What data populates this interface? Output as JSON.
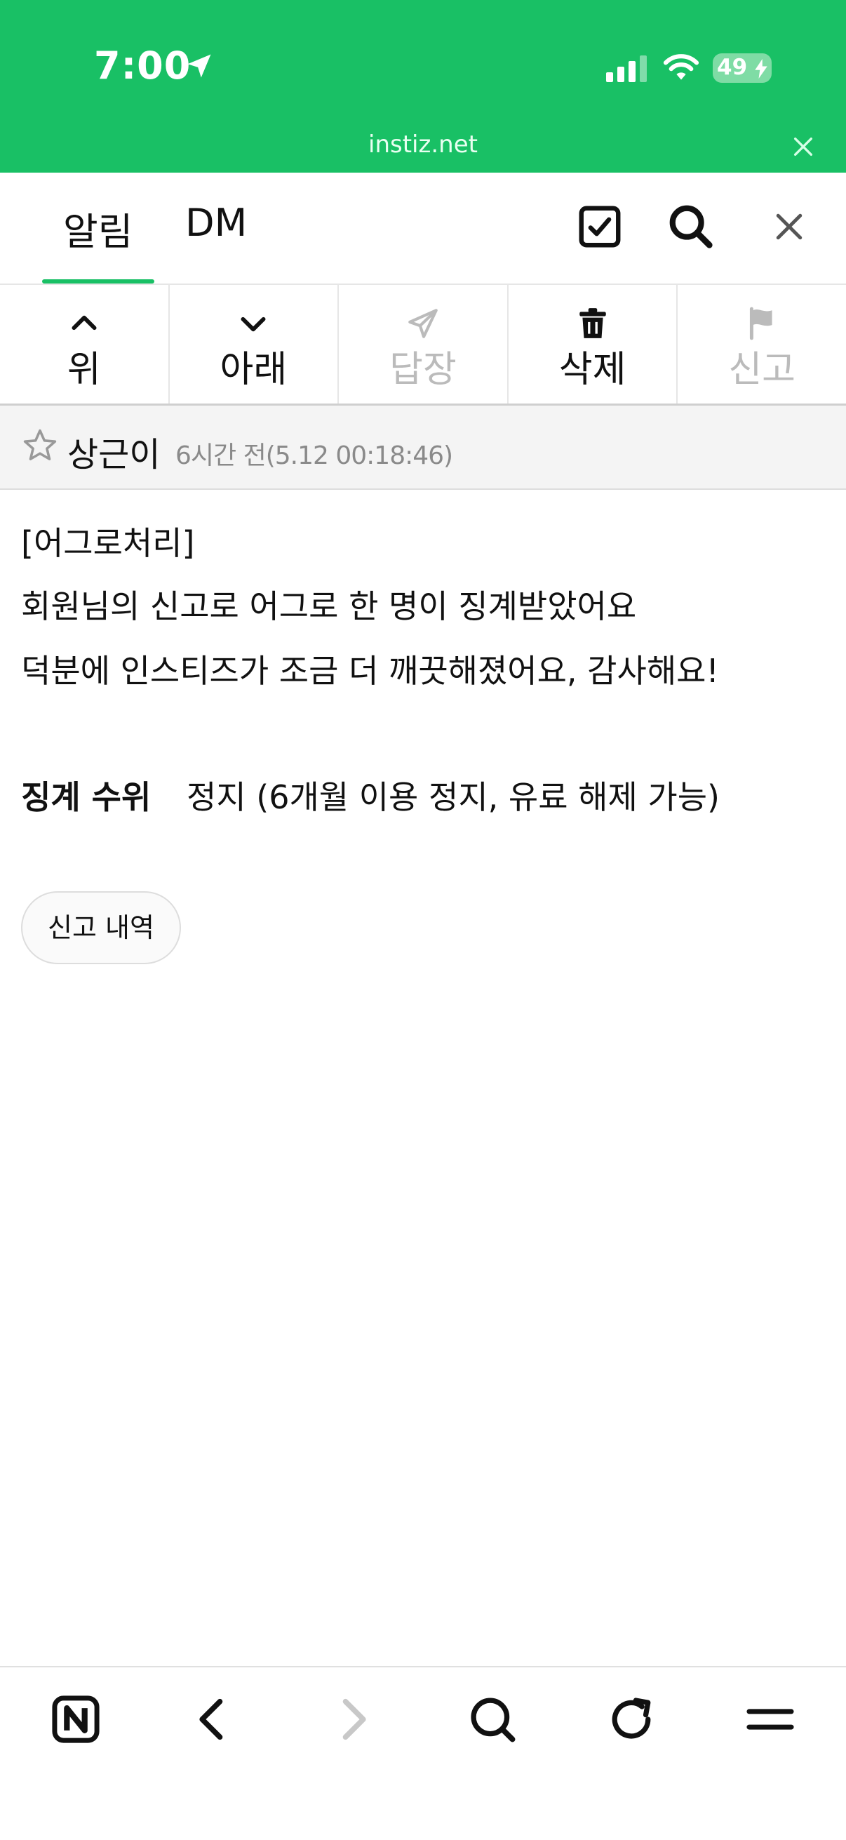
{
  "status_bar": {
    "time": "7:00",
    "battery": "49",
    "accent": "#19c065"
  },
  "browser": {
    "url": "instiz.net"
  },
  "tabs": [
    {
      "label": "알림",
      "active": true
    },
    {
      "label": "DM",
      "active": false
    }
  ],
  "header_icons": [
    "checkbox-icon",
    "search-icon",
    "close-icon"
  ],
  "actions": [
    {
      "label": "위",
      "icon": "chevron-up-icon",
      "enabled": true
    },
    {
      "label": "아래",
      "icon": "chevron-down-icon",
      "enabled": true
    },
    {
      "label": "답장",
      "icon": "paper-plane-icon",
      "enabled": false
    },
    {
      "label": "삭제",
      "icon": "trash-icon",
      "enabled": true
    },
    {
      "label": "신고",
      "icon": "flag-icon",
      "enabled": false
    }
  ],
  "message": {
    "sender": "상근이",
    "timestamp": "6시간 전(5.12 00:18:46)",
    "lines": [
      "[어그로처리]",
      "회원님의 신고로 어그로 한 명이 징계받았어요",
      "덕분에 인스티즈가 조금 더 깨끗해졌어요, 감사해요!"
    ],
    "penalty_label": "징계 수위",
    "penalty_value": "정지 (6개월 이용 정지, 유료 해제 가능)",
    "history_button": "신고 내역"
  },
  "bottom_nav": [
    "n-logo-icon",
    "back-icon",
    "forward-icon",
    "search-icon",
    "reload-icon",
    "menu-icon"
  ]
}
